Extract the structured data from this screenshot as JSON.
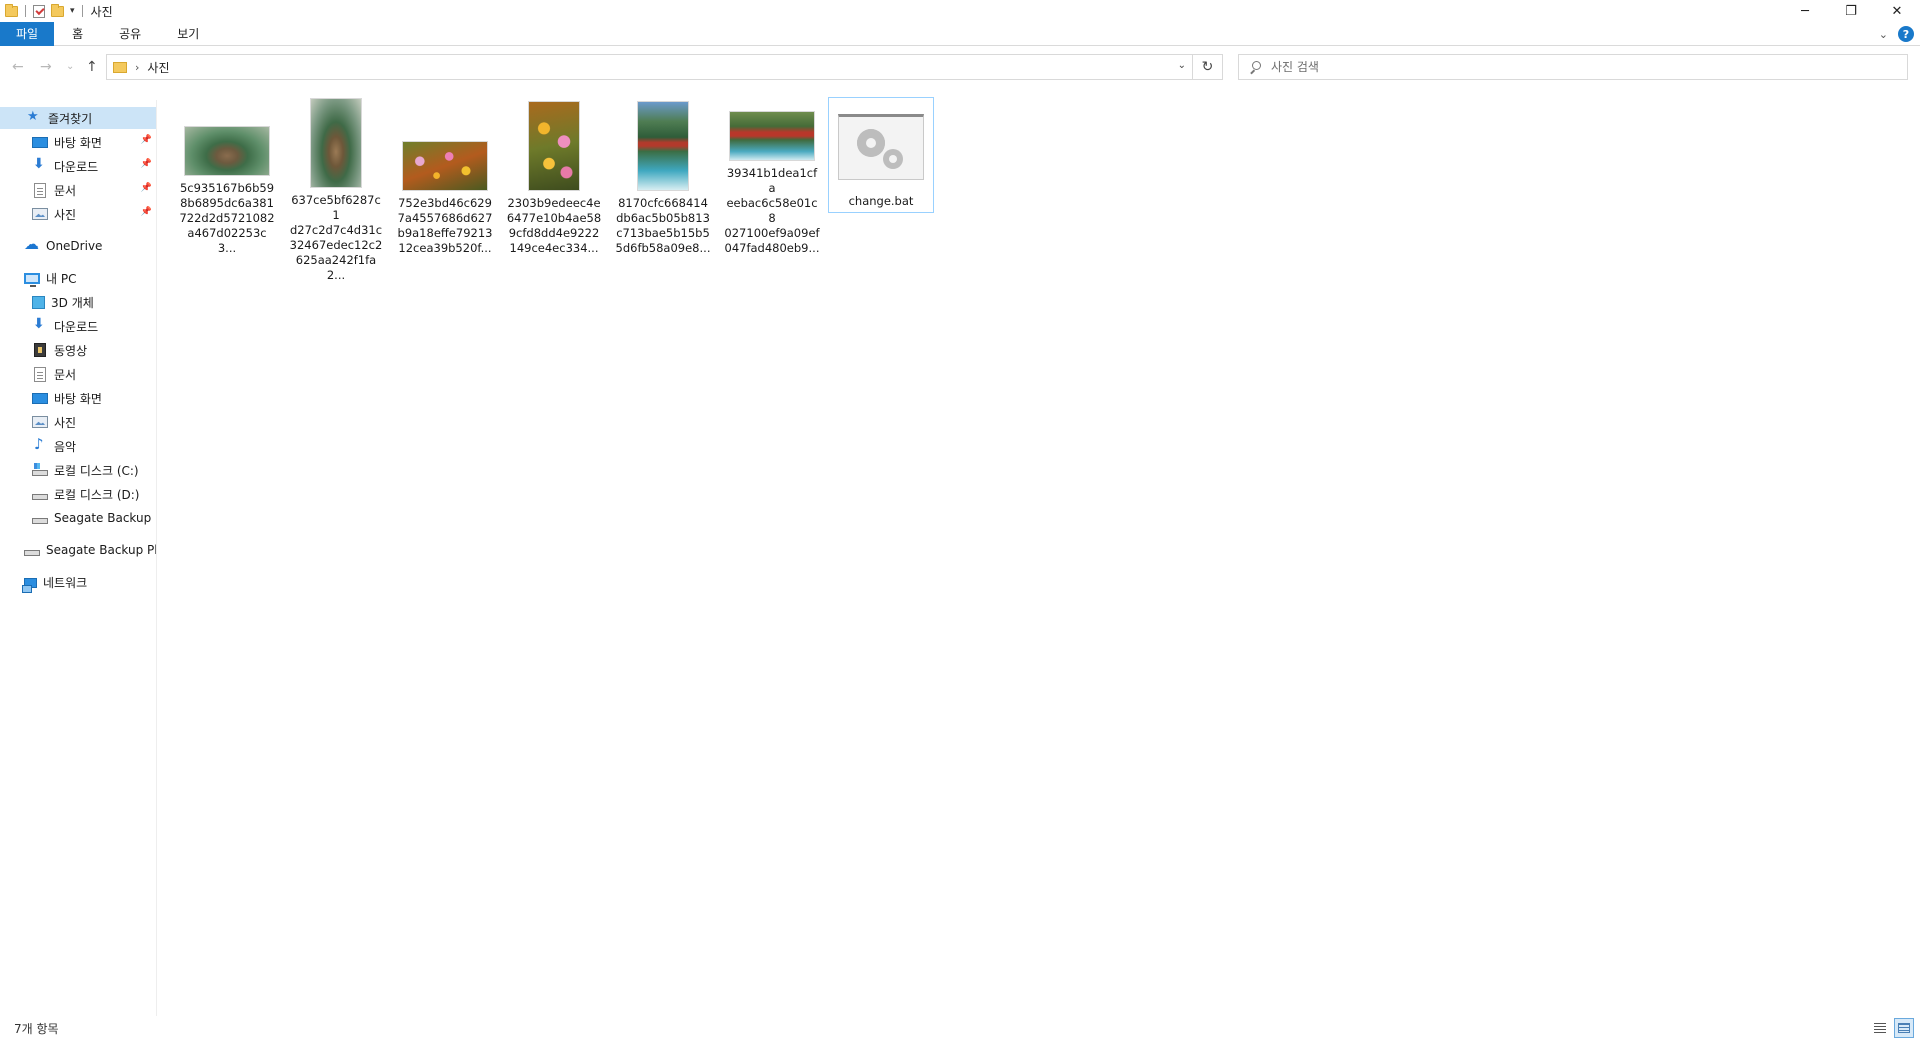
{
  "window": {
    "title": "사진",
    "minimize_label": "─",
    "restore_label": "❐",
    "close_label": "✕"
  },
  "ribbon": {
    "tabs": [
      "파일",
      "홈",
      "공유",
      "보기"
    ],
    "help_label": "?",
    "expand_label": "⌄"
  },
  "navigation": {
    "back_label": "←",
    "forward_label": "→",
    "recent_label": "⌄",
    "up_label": "↑"
  },
  "address": {
    "separator": "›",
    "path": "사진",
    "dropdown_label": "⌄",
    "refresh_label": "↻"
  },
  "search": {
    "placeholder": "사진 검색"
  },
  "sidebar": {
    "quick_access": {
      "label": "즐겨찾기",
      "items": [
        "바탕 화면",
        "다운로드",
        "문서",
        "사진"
      ]
    },
    "onedrive": "OneDrive",
    "this_pc": {
      "label": "내 PC",
      "items": [
        "3D 개체",
        "다운로드",
        "동영상",
        "문서",
        "바탕 화면",
        "사진",
        "음악",
        "로컬 디스크 (C:)",
        "로컬 디스크 (D:)",
        "Seagate Backup Plus"
      ]
    },
    "external_drive": "Seagate Backup Plus",
    "network": "네트워크"
  },
  "files": [
    {
      "name_line1": "5c935167b6b59",
      "name_line2": "8b6895dc6a381",
      "name_line3": "722d2d5721082",
      "name_line4": "a467d02253c3...",
      "thumbnail": "mountain-landscape"
    },
    {
      "name_line1": "637ce5bf6287c1",
      "name_line2": "d27c2d7c4d31c",
      "name_line3": "32467edec12c2",
      "name_line4": "625aa242f1fa2...",
      "thumbnail": "mountain-portrait"
    },
    {
      "name_line1": "752e3bd46c629",
      "name_line2": "7a4557686d627",
      "name_line3": "b9a18effe79213",
      "name_line4": "12cea39b520f...",
      "thumbnail": "flowers-landscape"
    },
    {
      "name_line1": "2303b9edeec4e",
      "name_line2": "6477e10b4ae58",
      "name_line3": "9cfd8dd4e9222",
      "name_line4": "149ce4ec334...",
      "thumbnail": "flowers-portrait"
    },
    {
      "name_line1": "8170cfc668414",
      "name_line2": "db6ac5b05b813",
      "name_line3": "c713bae5b15b5",
      "name_line4": "5d6fb58a09e8...",
      "thumbnail": "bridge-portrait"
    },
    {
      "name_line1": "39341b1dea1cfa",
      "name_line2": "eebac6c58e01c8",
      "name_line3": "027100ef9a09ef",
      "name_line4": "047fad480eb9...",
      "thumbnail": "bridge-landscape"
    },
    {
      "name_line1": "change.bat",
      "thumbnail": "batch-file-gears",
      "selected": true
    }
  ],
  "status": {
    "item_count": "7개 항목"
  },
  "colors": {
    "accent": "#1979ca",
    "selection": "#cce4f7",
    "selection_border": "#99d1ff"
  }
}
